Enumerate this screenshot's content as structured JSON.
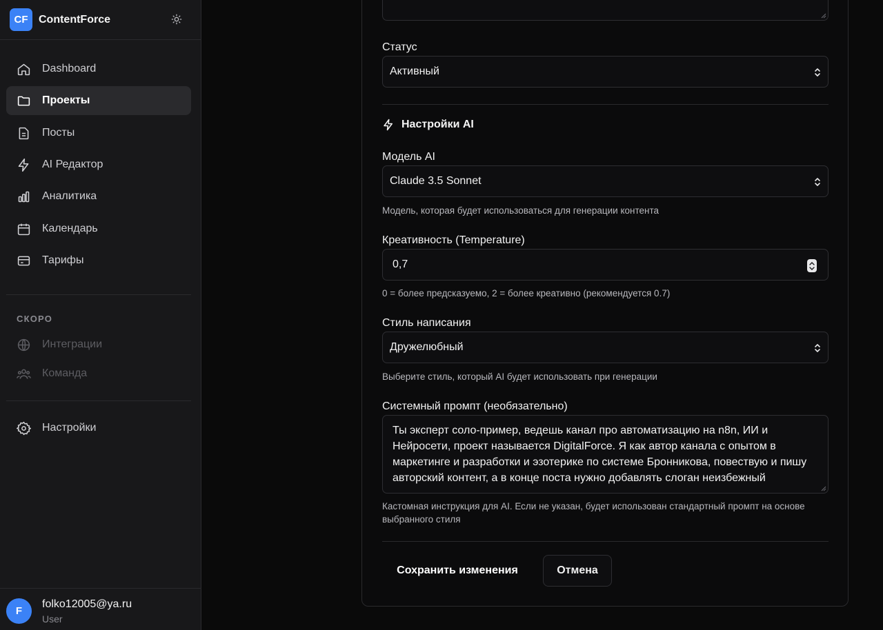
{
  "app": {
    "logo_text": "CF",
    "name": "ContentForce"
  },
  "sidebar": {
    "items": [
      {
        "label": "Dashboard",
        "icon": "home-icon"
      },
      {
        "label": "Проекты",
        "icon": "folder-icon",
        "active": true
      },
      {
        "label": "Посты",
        "icon": "document-icon"
      },
      {
        "label": "AI Редактор",
        "icon": "lightning-icon"
      },
      {
        "label": "Аналитика",
        "icon": "bar-chart-icon"
      },
      {
        "label": "Календарь",
        "icon": "calendar-icon"
      },
      {
        "label": "Тарифы",
        "icon": "credit-card-icon"
      }
    ],
    "soon_label": "СКОРО",
    "soon_items": [
      {
        "label": "Интеграции",
        "icon": "globe-icon"
      },
      {
        "label": "Команда",
        "icon": "users-icon"
      }
    ],
    "settings_label": "Настройки"
  },
  "user": {
    "initial": "F",
    "email": "folko12005@ya.ru",
    "role": "User"
  },
  "form": {
    "status": {
      "label": "Статус",
      "value": "Активный"
    },
    "ai_section_title": "Настройки AI",
    "model": {
      "label": "Модель AI",
      "value": "Claude 3.5 Sonnet",
      "help": "Модель, которая будет использоваться для генерации контента"
    },
    "temperature": {
      "label": "Креативность (Temperature)",
      "value": "0,7",
      "help": "0 = более предсказуемо, 2 = более креативно (рекомендуется 0.7)"
    },
    "style": {
      "label": "Стиль написания",
      "value": "Дружелюбный",
      "help": "Выберите стиль, который AI будет использовать при генерации"
    },
    "system_prompt": {
      "label": "Системный промпт (необязательно)",
      "value": "Ты эксперт соло-пример, ведешь канал про автоматизацию на n8n, ИИ и Нейросети, проект называется DigitalForce. Я как автор канала с опытом в маркетинге и разработки и эзотерике по системе Бронникова, повествую и пишу авторский контент, а в конце поста нужно добавлять слоган неизбежный",
      "help": "Кастомная инструкция для AI. Если не указан, будет использован стандартный промпт на основе выбранного стиля"
    },
    "save_label": "Сохранить изменения",
    "cancel_label": "Отмена"
  }
}
